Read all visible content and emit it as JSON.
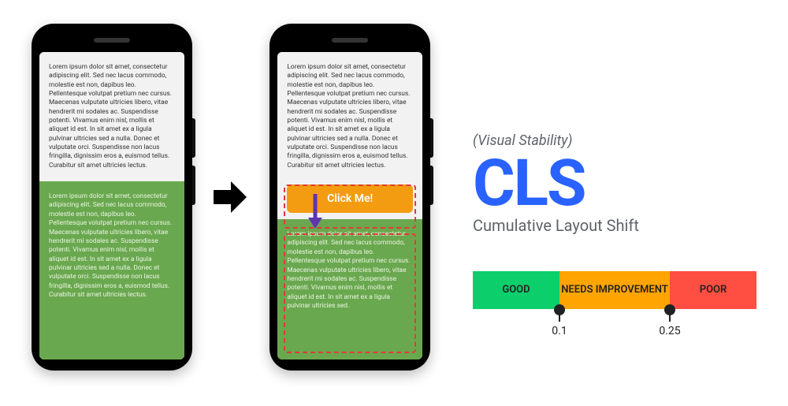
{
  "lorem_top": "Lorem ipsum dolor sit amet, consectetur adipiscing elit. Sed nec lacus commodo, molestie est non, dapibus leo. Pellentesque volutpat pretium nec cursus. Maecenas vulputate ultricies libero, vitae hendrerit mi sodales ac. Suspendisse potenti. Vivamus enim nisl, mollis et aliquet id est. In sit amet ex a ligula pulvinar ultricies sed a nulla. Donec et vulputate orci. Suspendisse non lacus fringilla, dignissim eros a, euismod tellus. Curabitur sit amet ultricies lectus.",
  "lorem_bottom": "Lorem ipsum dolor sit amet, consectetur adipiscing elit. Sed nec lacus commodo, molestie est non, dapibus leo. Pellentesque volutpat pretium nec cursus. Maecenas vulputate ultricies libero, vitae hendrerit mi sodales ac. Suspendisse potenti. Vivamus enim nisl, mollis et aliquet id est. In sit amet ex a ligula pulvinar ultricies sed a nulla. Donec et vulputate orci. Suspendisse non lacus fringilla, dignissim eros a, euismod tellus. Curabitur sit amet ultricies lectus.",
  "lorem_bottom_short": "Lorem ipsum dolor sit amet, consectetur adipiscing elit. Sed nec lacus commodo, molestie est non, dapibus leo. Pellentesque volutpat pretium nec cursus. Maecenas vulputate ultricies libero, vitae hendrerit mi sodales ac. Suspendisse potenti. Vivamus enim nisl, mollis et aliquet id est. In sit amet ex a ligula pulvinar ultricies sed.",
  "button_label": "Click Me!",
  "right": {
    "subtitle": "(Visual Stability)",
    "abbr": "CLS",
    "full": "Cumulative Layout Shift"
  },
  "scale": {
    "good": "GOOD",
    "mid": "NEEDS IMPROVEMENT",
    "poor": "POOR",
    "t1": "0.1",
    "t2": "0.25"
  }
}
